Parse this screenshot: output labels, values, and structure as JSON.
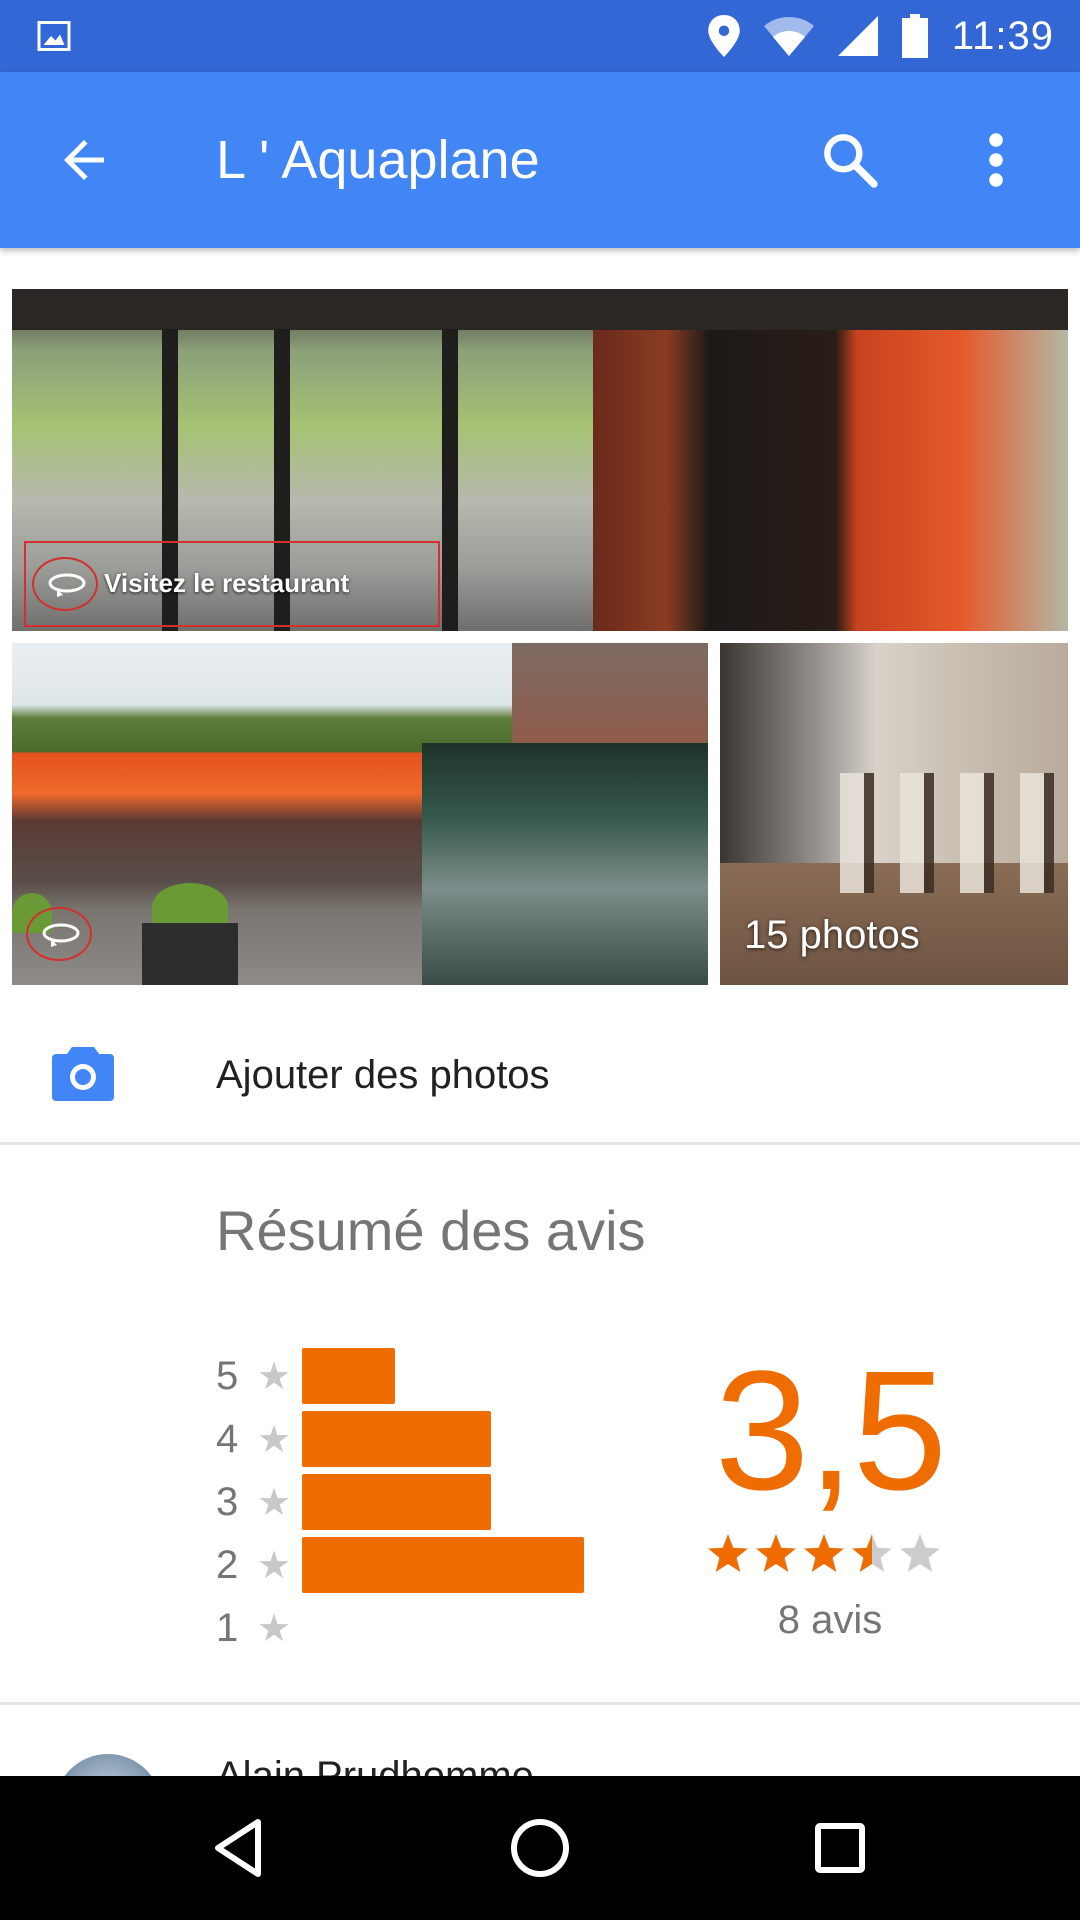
{
  "status_bar": {
    "time": "11:39",
    "icons": [
      "image-notification-icon",
      "location-icon",
      "wifi-icon",
      "signal-icon",
      "battery-icon"
    ]
  },
  "app_bar": {
    "title": "L ' Aquaplane",
    "icons": [
      "back-arrow-icon",
      "search-icon",
      "more-vert-icon"
    ],
    "color": "#4285f4"
  },
  "photos": {
    "tour_label": "Visitez le restaurant",
    "count_label": "15 photos"
  },
  "add_photos": {
    "label": "Ajouter des photos"
  },
  "reviews_summary": {
    "title": "Résumé des avis",
    "score": "3,5",
    "review_count": "8 avis",
    "rating": 3.5,
    "max_rating": 5,
    "accent_color": "#ef6c00",
    "distribution": [
      {
        "stars": "5",
        "fraction": 0.33
      },
      {
        "stars": "4",
        "fraction": 0.67
      },
      {
        "stars": "3",
        "fraction": 0.67
      },
      {
        "stars": "2",
        "fraction": 1.0
      },
      {
        "stars": "1",
        "fraction": 0.0
      }
    ]
  },
  "first_review": {
    "author": "Alain Prudhomme"
  },
  "nav_bar": {
    "icons": [
      "back-triangle-icon",
      "home-circle-icon",
      "recents-square-icon"
    ]
  }
}
